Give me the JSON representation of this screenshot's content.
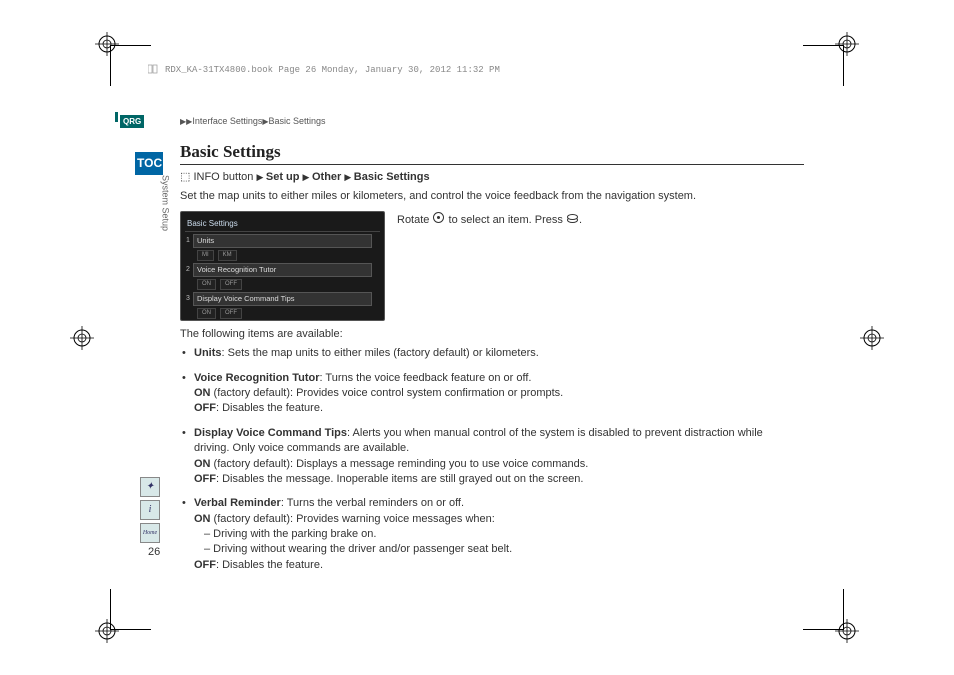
{
  "header_info": "RDX_KA-31TX4800.book  Page 26  Monday, January 30, 2012  11:32 PM",
  "breadcrumb": {
    "l1": "Interface Settings",
    "l2": "Basic Settings"
  },
  "qrg": "QRG",
  "toc": "TOC",
  "side_label": "System Setup",
  "title": "Basic Settings",
  "nav_path": {
    "prefix": "INFO button",
    "p1": "Set up",
    "p2": "Other",
    "p3": "Basic Settings"
  },
  "intro": "Set the map units to either miles or kilometers, and control the voice feedback from the navigation system.",
  "instruction": {
    "a": "Rotate",
    "b": "to select an item. Press",
    "c": "."
  },
  "screenshot": {
    "title": "Basic Settings",
    "items": [
      {
        "n": "1",
        "label": "Units",
        "opts": [
          "MI",
          "KM"
        ]
      },
      {
        "n": "2",
        "label": "Voice Recognition Tutor",
        "opts": [
          "ON",
          "OFF"
        ]
      },
      {
        "n": "3",
        "label": "Display Voice Command Tips",
        "opts": [
          "ON",
          "OFF"
        ]
      }
    ]
  },
  "list_intro": "The following items are available:",
  "items": [
    {
      "name": "Units",
      "colon_text": ": Sets the map units to either miles (factory default) or kilometers.",
      "lines": []
    },
    {
      "name": "Voice Recognition Tutor",
      "colon_text": ": Turns the voice feedback feature on or off.",
      "lines": [
        {
          "b": "ON",
          "t": " (factory default): Provides voice control system confirmation or prompts."
        },
        {
          "b": "OFF",
          "t": ": Disables the feature."
        }
      ]
    },
    {
      "name": "Display Voice Command Tips",
      "colon_text": ": Alerts you when manual control of the system is disabled to prevent distraction while driving. Only voice commands are available.",
      "lines": [
        {
          "b": "ON",
          "t": " (factory default): Displays a message reminding you to use voice commands."
        },
        {
          "b": "OFF",
          "t": ": Disables the message. Inoperable items are still grayed out on the screen."
        }
      ]
    },
    {
      "name": "Verbal Reminder",
      "colon_text": ": Turns the verbal reminders on or off.",
      "lines": [
        {
          "b": "ON",
          "t": " (factory default): Provides warning voice messages when:"
        },
        {
          "indent": true,
          "t": "– Driving with the parking brake on."
        },
        {
          "indent": true,
          "t": "– Driving without wearing the driver and/or passenger seat belt."
        },
        {
          "b": "OFF",
          "t": ": Disables the feature."
        }
      ]
    }
  ],
  "left_icons": [
    "✦",
    "i",
    "Home"
  ],
  "page_num": "26"
}
